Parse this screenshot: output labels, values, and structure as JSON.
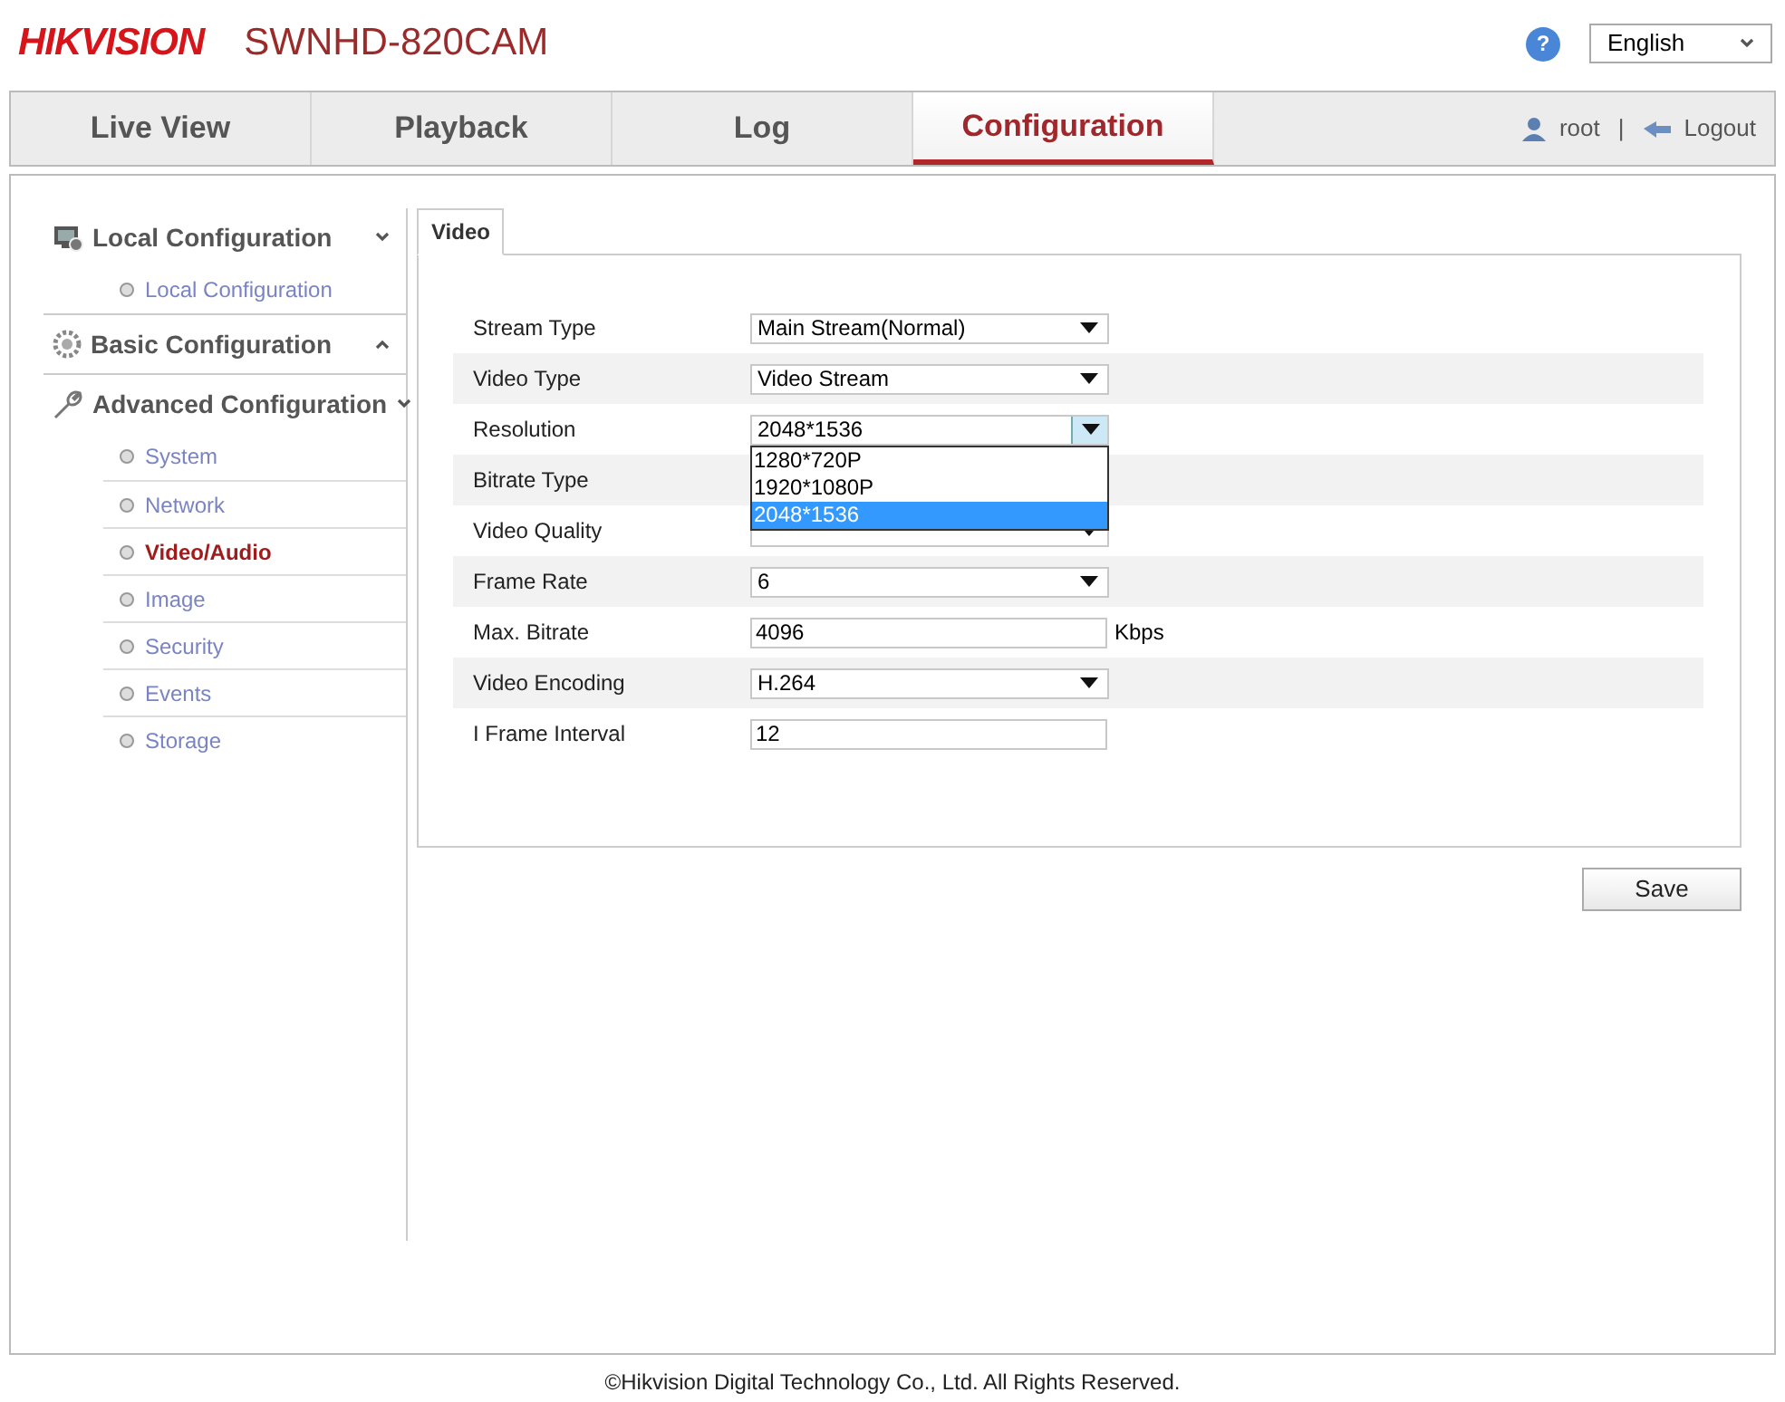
{
  "header": {
    "logo": "HIKVISION",
    "model": "SWNHD-820CAM",
    "help": "?",
    "language": "English"
  },
  "nav": {
    "tabs": [
      {
        "label": "Live View",
        "selected": false
      },
      {
        "label": "Playback",
        "selected": false
      },
      {
        "label": "Log",
        "selected": false
      },
      {
        "label": "Configuration",
        "selected": true
      }
    ],
    "user": "root",
    "separator": "|",
    "logout": "Logout"
  },
  "sidebar": {
    "groups": [
      {
        "label": "Local Configuration",
        "expanded": true,
        "children": [
          {
            "label": "Local Configuration",
            "selected": false
          }
        ]
      },
      {
        "label": "Basic Configuration",
        "expanded": false
      },
      {
        "label": "Advanced Configuration",
        "expanded": true,
        "children": [
          {
            "label": "System",
            "selected": false
          },
          {
            "label": "Network",
            "selected": false
          },
          {
            "label": "Video/Audio",
            "selected": true
          },
          {
            "label": "Image",
            "selected": false
          },
          {
            "label": "Security",
            "selected": false
          },
          {
            "label": "Events",
            "selected": false
          },
          {
            "label": "Storage",
            "selected": false
          }
        ]
      }
    ]
  },
  "tabs": [
    {
      "label": "Video",
      "selected": true
    }
  ],
  "form": {
    "rows": [
      {
        "kind": "select",
        "label": "Stream Type",
        "value": "Main Stream(Normal)"
      },
      {
        "kind": "select",
        "label": "Video Type",
        "value": "Video Stream"
      },
      {
        "kind": "select",
        "label": "Resolution",
        "value": "2048*1536",
        "expanded": true,
        "options": [
          {
            "label": "1280*720P",
            "selected": false
          },
          {
            "label": "1920*1080P",
            "selected": false
          },
          {
            "label": "2048*1536",
            "selected": true
          }
        ]
      },
      {
        "kind": "covered",
        "label": "Bitrate Type"
      },
      {
        "kind": "select",
        "label": "Video Quality"
      },
      {
        "kind": "select",
        "label": "Frame Rate",
        "value": "6"
      },
      {
        "kind": "text",
        "label": "Max. Bitrate",
        "value": "4096",
        "unit": "Kbps"
      },
      {
        "kind": "select",
        "label": "Video Encoding",
        "value": "H.264"
      },
      {
        "kind": "text",
        "label": "I Frame Interval",
        "value": "12"
      }
    ]
  },
  "save": "Save",
  "footer": "©Hikvision Digital Technology Co., Ltd. All Rights Reserved."
}
